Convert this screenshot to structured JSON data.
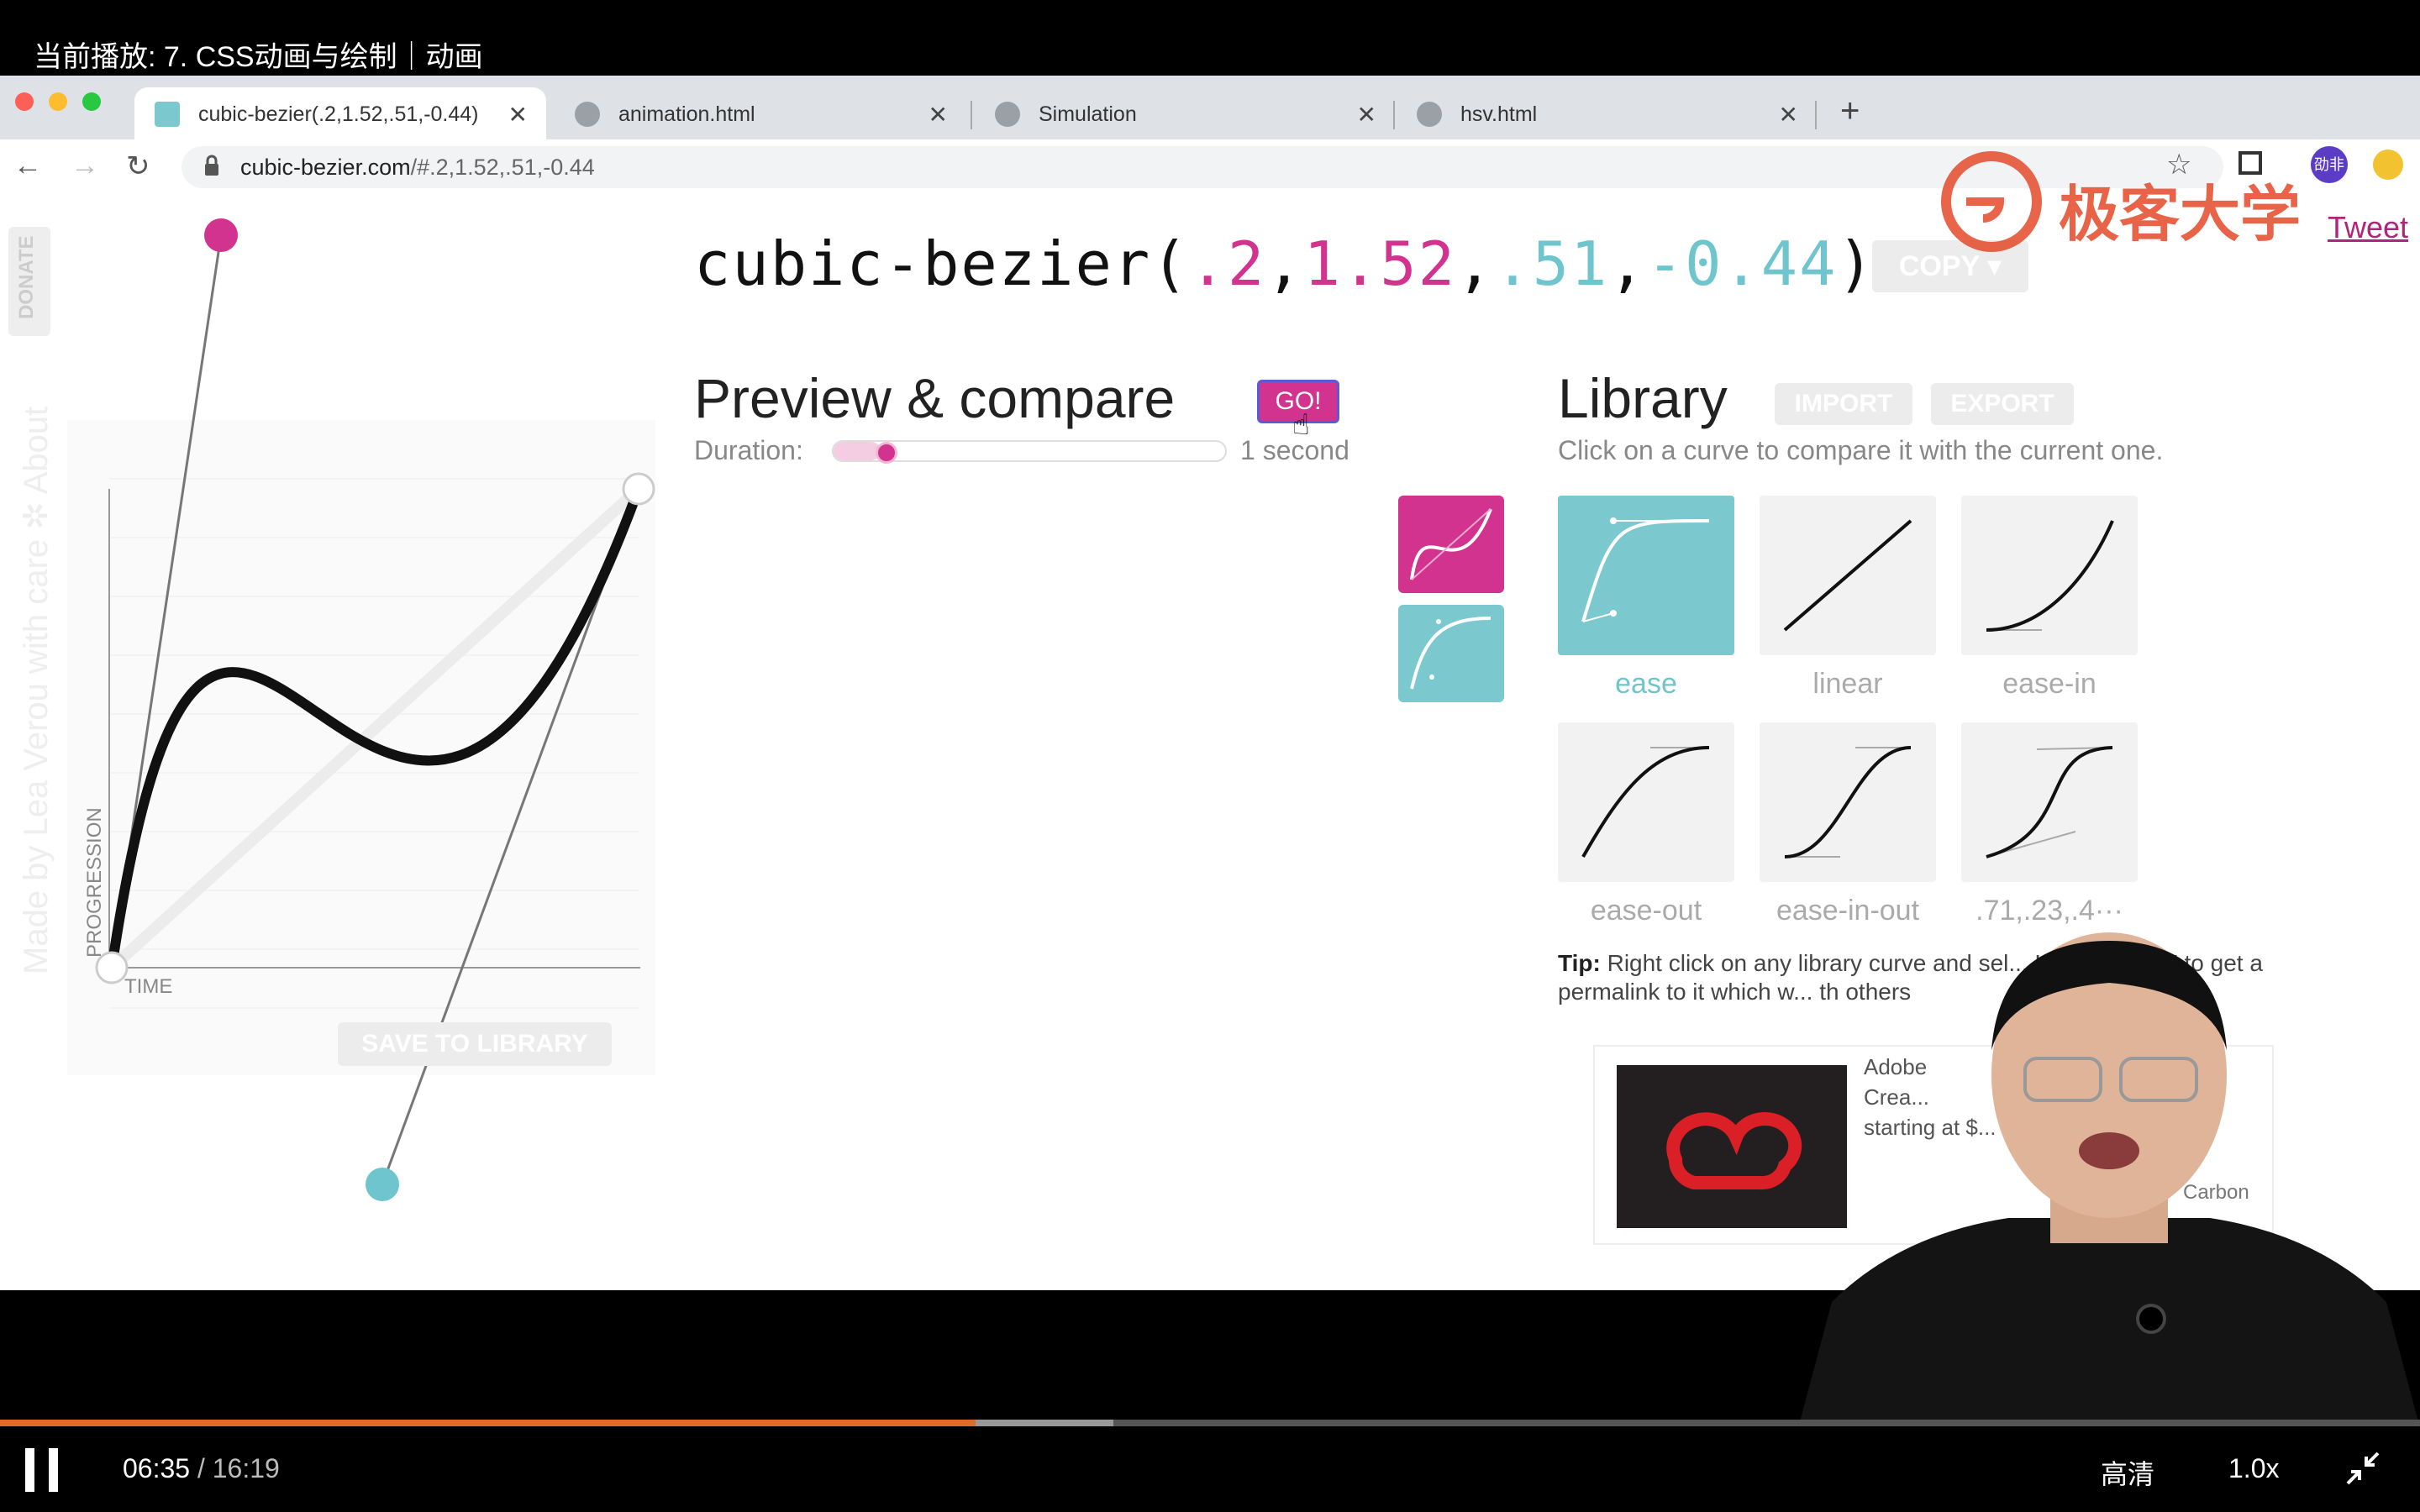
{
  "player": {
    "now_playing": "当前播放: 7. CSS动画与绘制｜动画",
    "current_time": "06:35",
    "separator": " / ",
    "duration": "16:19",
    "quality": "高清",
    "speed": "1.0x",
    "progress": 0.403,
    "buffered_to": 0.46
  },
  "browser": {
    "tabs": [
      {
        "title": "cubic-bezier(.2,1.52,.51,-0.44)",
        "active": true
      },
      {
        "title": "animation.html",
        "active": false
      },
      {
        "title": "Simulation",
        "active": false
      },
      {
        "title": "hsv.html",
        "active": false
      }
    ],
    "new_tab": "+",
    "close_glyph": "✕",
    "url_host": "cubic-bezier.com",
    "url_path": "/#.2,1.52,.51,-0.44",
    "profile_badge": "劭非"
  },
  "editor": {
    "side_tab": "DONATE",
    "made_by": "Made by Lea Verou with care ✲ About",
    "y_axis_label": "PROGRESSION",
    "x_axis_label": "TIME",
    "save_button": "SAVE TO LIBRARY",
    "control_points": [
      0.2,
      1.52,
      0.51,
      -0.44
    ]
  },
  "header": {
    "fn_open": "cubic-bezier(",
    "p1": ".2",
    "p2": "1.52",
    "p3": ".51",
    "p4": "-0.44",
    "comma": ",",
    "fn_close": ")",
    "copy_button": "COPY ▾",
    "tweet": "Tweet"
  },
  "preview": {
    "title": "Preview & compare",
    "go_button": "GO!",
    "duration_label": "Duration:",
    "duration_value": "1 second",
    "duration_level": 0.09,
    "accent_magenta": "#d1338f",
    "accent_cyan": "#6ec5cd"
  },
  "library": {
    "title": "Library",
    "import_button": "IMPORT",
    "export_button": "EXPORT",
    "subtitle": "Click on a curve to compare it with the current one.",
    "items": [
      {
        "label": "ease",
        "selected": true
      },
      {
        "label": "linear",
        "selected": false
      },
      {
        "label": "ease-in",
        "selected": false
      },
      {
        "label": "ease-out",
        "selected": false
      },
      {
        "label": "ease-in-out",
        "selected": false
      },
      {
        "label": ".71,.23,.4···",
        "selected": false
      }
    ],
    "tip_bold": "Tip:",
    "tip_text": " Right click on any library curve and sel... Link Address\" to get a permalink to it which w... th others"
  },
  "ad": {
    "text": "Adobe Crea... starting at $...",
    "carbon": "Carbon"
  },
  "watermark": {
    "text": "极客大学"
  }
}
